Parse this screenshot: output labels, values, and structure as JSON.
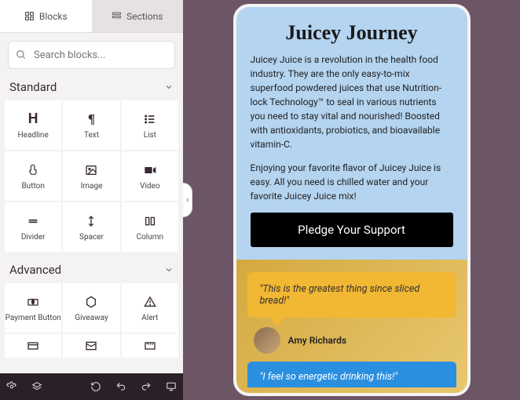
{
  "tabs": {
    "blocks": "Blocks",
    "sections": "Sections"
  },
  "search": {
    "placeholder": "Search blocks..."
  },
  "cat1": "Standard",
  "cat2": "Advanced",
  "std": [
    {
      "label": "Headline"
    },
    {
      "label": "Text"
    },
    {
      "label": "List"
    },
    {
      "label": "Button"
    },
    {
      "label": "Image"
    },
    {
      "label": "Video"
    },
    {
      "label": "Divider"
    },
    {
      "label": "Spacer"
    },
    {
      "label": "Column"
    }
  ],
  "adv": [
    {
      "label": "Payment Button"
    },
    {
      "label": "Giveaway"
    },
    {
      "label": "Alert"
    }
  ],
  "page": {
    "title": "Juicey Journey",
    "p1": "Juicey Juice is a revolution in the health food industry. They are the only easy-to-mix superfood powdered juices that use Nutrition-lock Technology™ to seal in various nutrients you need to stay vital and nourished! Boosted with antioxidants, probiotics, and bioavailable vitamin-C.",
    "p2": "Enjoying your favorite flavor of Juicey Juice is easy. All you need is chilled water and your favorite Juicey Juice mix!",
    "cta": "Pledge Your Support",
    "t1": "\"This is the greatest thing since sliced bread!\"",
    "a1": "Amy Richards",
    "t2": "\"I feel so energetic drinking this!\""
  }
}
